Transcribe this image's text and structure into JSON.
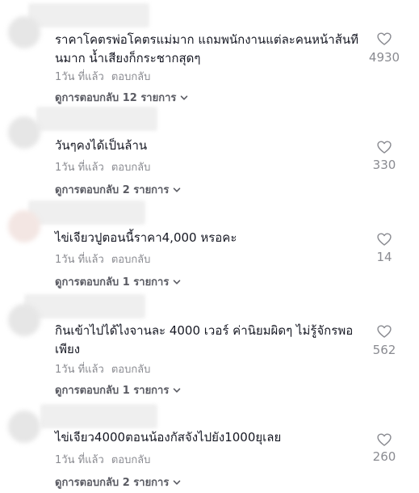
{
  "comments": [
    {
      "text": "ราคาโคตรพ่อโคตรแม่มาก แถมพนักงานแต่ละคนหน้าส้นทีนมาก น้ำเสียงก็กระชากสุดๆ",
      "time": "1วัน ที่แล้ว",
      "reply_label": "ตอบกลับ",
      "view_replies": "ดูการตอบกลับ 12 รายการ",
      "likes": "4930",
      "like_icon": "heart-outline-icon",
      "expand_icon": "chevron-down-icon"
    },
    {
      "text": "วันๆคงได้เป็นล้าน",
      "time": "1วัน ที่แล้ว",
      "reply_label": "ตอบกลับ",
      "view_replies": "ดูการตอบกลับ 2 รายการ",
      "likes": "330",
      "like_icon": "heart-outline-icon",
      "expand_icon": "chevron-down-icon"
    },
    {
      "text": "ไข่เจียวปูตอนนี้ราคา4,000 หรอคะ",
      "time": "1วัน ที่แล้ว",
      "reply_label": "ตอบกลับ",
      "view_replies": "ดูการตอบกลับ 1 รายการ",
      "likes": "14",
      "like_icon": "heart-outline-icon",
      "expand_icon": "chevron-down-icon"
    },
    {
      "text": "กินเข้าไปได้ไงจานละ 4000 เวอร์ ค่านิยมผิดๆ ไม่รู้จักรพอเพียง",
      "time": "1วัน ที่แล้ว",
      "reply_label": "ตอบกลับ",
      "view_replies": "ดูการตอบกลับ 1 รายการ",
      "likes": "562",
      "like_icon": "heart-outline-icon",
      "expand_icon": "chevron-down-icon"
    },
    {
      "text": "ไข่เจียว4000ตอนน้องกัสจังไปยัง1000ยุเลย",
      "time": "1วัน ที่แล้ว",
      "reply_label": "ตอบกลับ",
      "view_replies": "ดูการตอบกลับ 2 รายการ",
      "likes": "260",
      "like_icon": "heart-outline-icon",
      "expand_icon": "chevron-down-icon"
    }
  ],
  "colors": {
    "text": "#161823",
    "meta": "#8a8b91",
    "view_replies": "#5a5b63",
    "redaction_blur": "#efefef"
  }
}
